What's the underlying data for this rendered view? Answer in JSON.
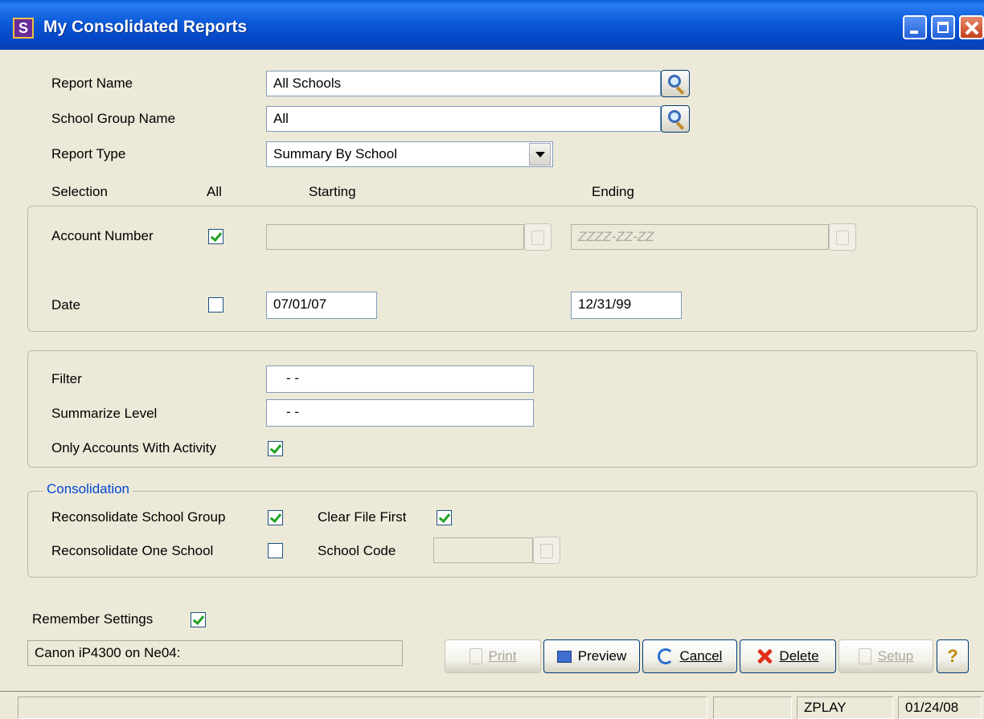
{
  "window": {
    "title": "My Consolidated Reports",
    "app_icon_letter": "S"
  },
  "form": {
    "report_name_label": "Report Name",
    "report_name_value": "All Schools",
    "school_group_label": "School Group Name",
    "school_group_value": "All",
    "report_type_label": "Report Type",
    "report_type_value": "Summary By School"
  },
  "selection": {
    "header_selection": "Selection",
    "header_all": "All",
    "header_starting": "Starting",
    "header_ending": "Ending",
    "account_label": "Account Number",
    "account_all": true,
    "account_start": "",
    "account_end": "ZZZZ-ZZ-ZZ",
    "date_label": "Date",
    "date_all": false,
    "date_start": "07/01/07",
    "date_end": "12/31/99"
  },
  "options": {
    "filter_label": "Filter",
    "filter_value": "  -  -",
    "summarize_label": "Summarize Level",
    "summarize_value": "  -  -",
    "only_active_label": "Only Accounts With Activity",
    "only_active": true
  },
  "consolidation": {
    "legend": "Consolidation",
    "recon_group_label": "Reconsolidate School Group",
    "recon_group": true,
    "clear_file_label": "Clear File First",
    "clear_file": true,
    "recon_one_label": "Reconsolidate One School",
    "recon_one": false,
    "school_code_label": "School Code",
    "school_code_value": ""
  },
  "footer": {
    "remember_label": "Remember Settings",
    "remember": true,
    "printer": "Canon iP4300 on Ne04:",
    "buttons": {
      "print": "Print",
      "preview": "Preview",
      "cancel": "Cancel",
      "delete": "Delete",
      "setup": "Setup",
      "help": "?"
    }
  },
  "statusbar": {
    "user": "ZPLAY",
    "date": "01/24/08"
  },
  "colors": {
    "titlebar": "#0b59d8",
    "window_bg": "#ece9d8",
    "legend_text": "#0046d5",
    "checkmark": "#21a121"
  }
}
